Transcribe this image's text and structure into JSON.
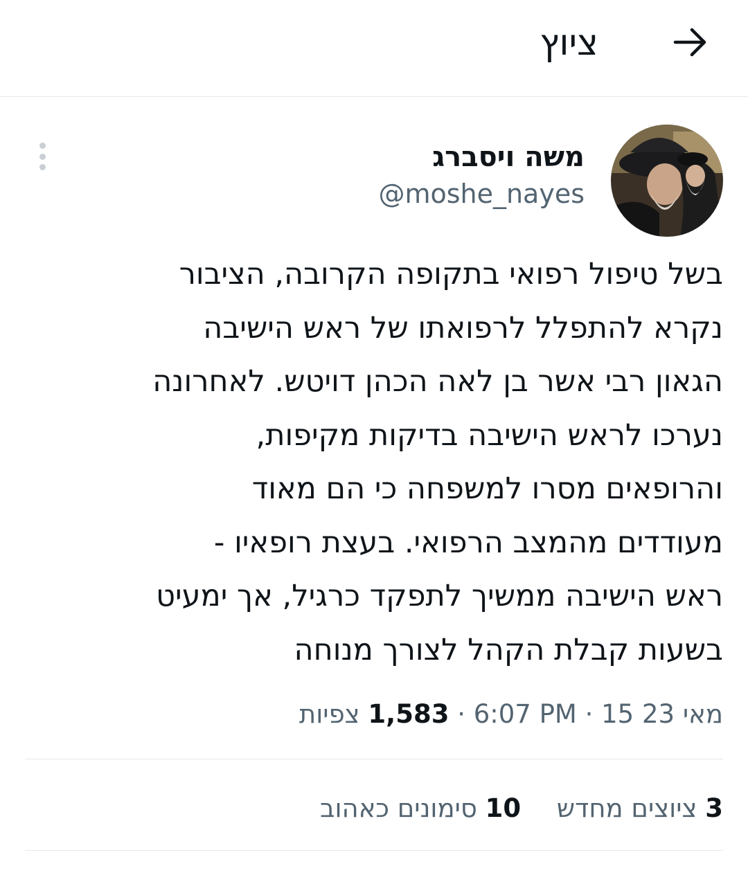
{
  "header": {
    "title": "ציוץ",
    "back_icon": "arrow-right-icon"
  },
  "tweet": {
    "author": {
      "display_name": "משה ויסברג",
      "handle": "@moshe_nayes"
    },
    "more_icon": "more-vertical-icon",
    "body_lines": [
      "בשל טיפול רפואי בתקופה הקרובה, הציבור",
      "נקרא להתפלל לרפואתו של ראש הישיבה",
      "הגאון רבי אשר בן לאה הכהן דויטש. לאחרונה",
      "נערכו לראש הישיבה בדיקות מקיפות,",
      "והרופאים מסרו למשפחה כי הם מאוד",
      "מעודדים מהמצב הרפואי. בעצת רופאיו -",
      "ראש הישיבה ממשיך לתפקד כרגיל, אך ימעיט",
      "בשעות קבלת הקהל לצורך מנוחה"
    ],
    "meta": {
      "date": "מאי 23 15",
      "separator": "·",
      "time": "6:07 PM",
      "views_count": "1,583",
      "views_label": "צפיות"
    },
    "stats": [
      {
        "count": "3",
        "label": "ציוצים מחדש"
      },
      {
        "count": "10",
        "label": "סימונים כאהוב"
      }
    ]
  },
  "colors": {
    "primary_text": "#0f1419",
    "secondary_text": "#536471",
    "divider": "#e6e9ec"
  }
}
